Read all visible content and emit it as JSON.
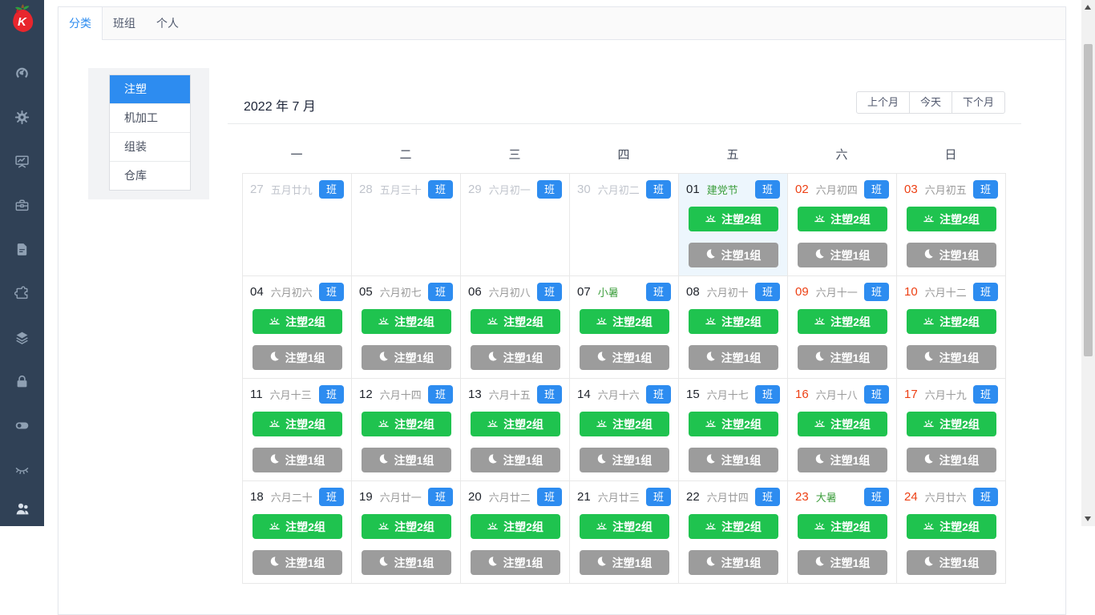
{
  "sidebar": {
    "items": [
      {
        "key": "dashboard",
        "icon": "dashboard-icon"
      },
      {
        "key": "settings",
        "icon": "gear-icon"
      },
      {
        "key": "monitor",
        "icon": "chart-board-icon"
      },
      {
        "key": "toolbox",
        "icon": "briefcase-icon"
      },
      {
        "key": "documents",
        "icon": "document-icon"
      },
      {
        "key": "plugins",
        "icon": "puzzle-icon"
      },
      {
        "key": "layers",
        "icon": "layers-icon"
      },
      {
        "key": "security",
        "icon": "lock-icon"
      },
      {
        "key": "switch",
        "icon": "toggle-icon"
      },
      {
        "key": "privacy",
        "icon": "eye-closed-icon"
      }
    ],
    "bottom_item": {
      "key": "users",
      "icon": "team-icon"
    }
  },
  "tabs": {
    "items": [
      {
        "key": "category",
        "label": "分类",
        "active": true
      },
      {
        "key": "team",
        "label": "班组",
        "active": false
      },
      {
        "key": "personal",
        "label": "个人",
        "active": false
      }
    ]
  },
  "category_menu": {
    "items": [
      {
        "key": "injection",
        "label": "注塑",
        "active": true
      },
      {
        "key": "machining",
        "label": "机加工",
        "active": false
      },
      {
        "key": "assembly",
        "label": "组装",
        "active": false
      },
      {
        "key": "warehouse",
        "label": "仓库",
        "active": false
      }
    ]
  },
  "calendar": {
    "title": "2022 年 7 月",
    "nav": {
      "prev": "上个月",
      "today": "今天",
      "next": "下个月"
    },
    "weekdays": [
      "一",
      "二",
      "三",
      "四",
      "五",
      "六",
      "日"
    ],
    "badge_label": "班",
    "day_shift": "注塑2组",
    "night_shift": "注塑1组",
    "weeks": [
      [
        {
          "num": "27",
          "lunar": "五月廿九",
          "out": true
        },
        {
          "num": "28",
          "lunar": "五月三十",
          "out": true
        },
        {
          "num": "29",
          "lunar": "六月初一",
          "out": true
        },
        {
          "num": "30",
          "lunar": "六月初二",
          "out": true
        },
        {
          "num": "01",
          "lunar": "建党节",
          "festival": true,
          "selected": true,
          "shifts": true
        },
        {
          "num": "02",
          "lunar": "六月初四",
          "weekend": true,
          "shifts": true
        },
        {
          "num": "03",
          "lunar": "六月初五",
          "weekend": true,
          "shifts": true
        }
      ],
      [
        {
          "num": "04",
          "lunar": "六月初六",
          "shifts": true
        },
        {
          "num": "05",
          "lunar": "六月初七",
          "shifts": true
        },
        {
          "num": "06",
          "lunar": "六月初八",
          "shifts": true
        },
        {
          "num": "07",
          "lunar": "小暑",
          "festival": true,
          "shifts": true
        },
        {
          "num": "08",
          "lunar": "六月初十",
          "shifts": true
        },
        {
          "num": "09",
          "lunar": "六月十一",
          "weekend": true,
          "shifts": true
        },
        {
          "num": "10",
          "lunar": "六月十二",
          "weekend": true,
          "shifts": true
        }
      ],
      [
        {
          "num": "11",
          "lunar": "六月十三",
          "shifts": true
        },
        {
          "num": "12",
          "lunar": "六月十四",
          "shifts": true
        },
        {
          "num": "13",
          "lunar": "六月十五",
          "shifts": true
        },
        {
          "num": "14",
          "lunar": "六月十六",
          "shifts": true
        },
        {
          "num": "15",
          "lunar": "六月十七",
          "shifts": true
        },
        {
          "num": "16",
          "lunar": "六月十八",
          "weekend": true,
          "shifts": true
        },
        {
          "num": "17",
          "lunar": "六月十九",
          "weekend": true,
          "shifts": true
        }
      ],
      [
        {
          "num": "18",
          "lunar": "六月二十",
          "shifts": true
        },
        {
          "num": "19",
          "lunar": "六月廿一",
          "shifts": true
        },
        {
          "num": "20",
          "lunar": "六月廿二",
          "shifts": true
        },
        {
          "num": "21",
          "lunar": "六月廿三",
          "shifts": true
        },
        {
          "num": "22",
          "lunar": "六月廿四",
          "shifts": true
        },
        {
          "num": "23",
          "lunar": "大暑",
          "festival": true,
          "weekend": true,
          "shifts": true
        },
        {
          "num": "24",
          "lunar": "六月廿六",
          "weekend": true,
          "shifts": true
        }
      ]
    ]
  },
  "colors": {
    "sidebar_bg": "#304156",
    "accent_blue": "#2d8cf0",
    "shift_green": "#1fc34f",
    "shift_gray": "#9c9c9c",
    "weekend_red": "#ed4014",
    "festival_green": "#3c9e3c"
  }
}
